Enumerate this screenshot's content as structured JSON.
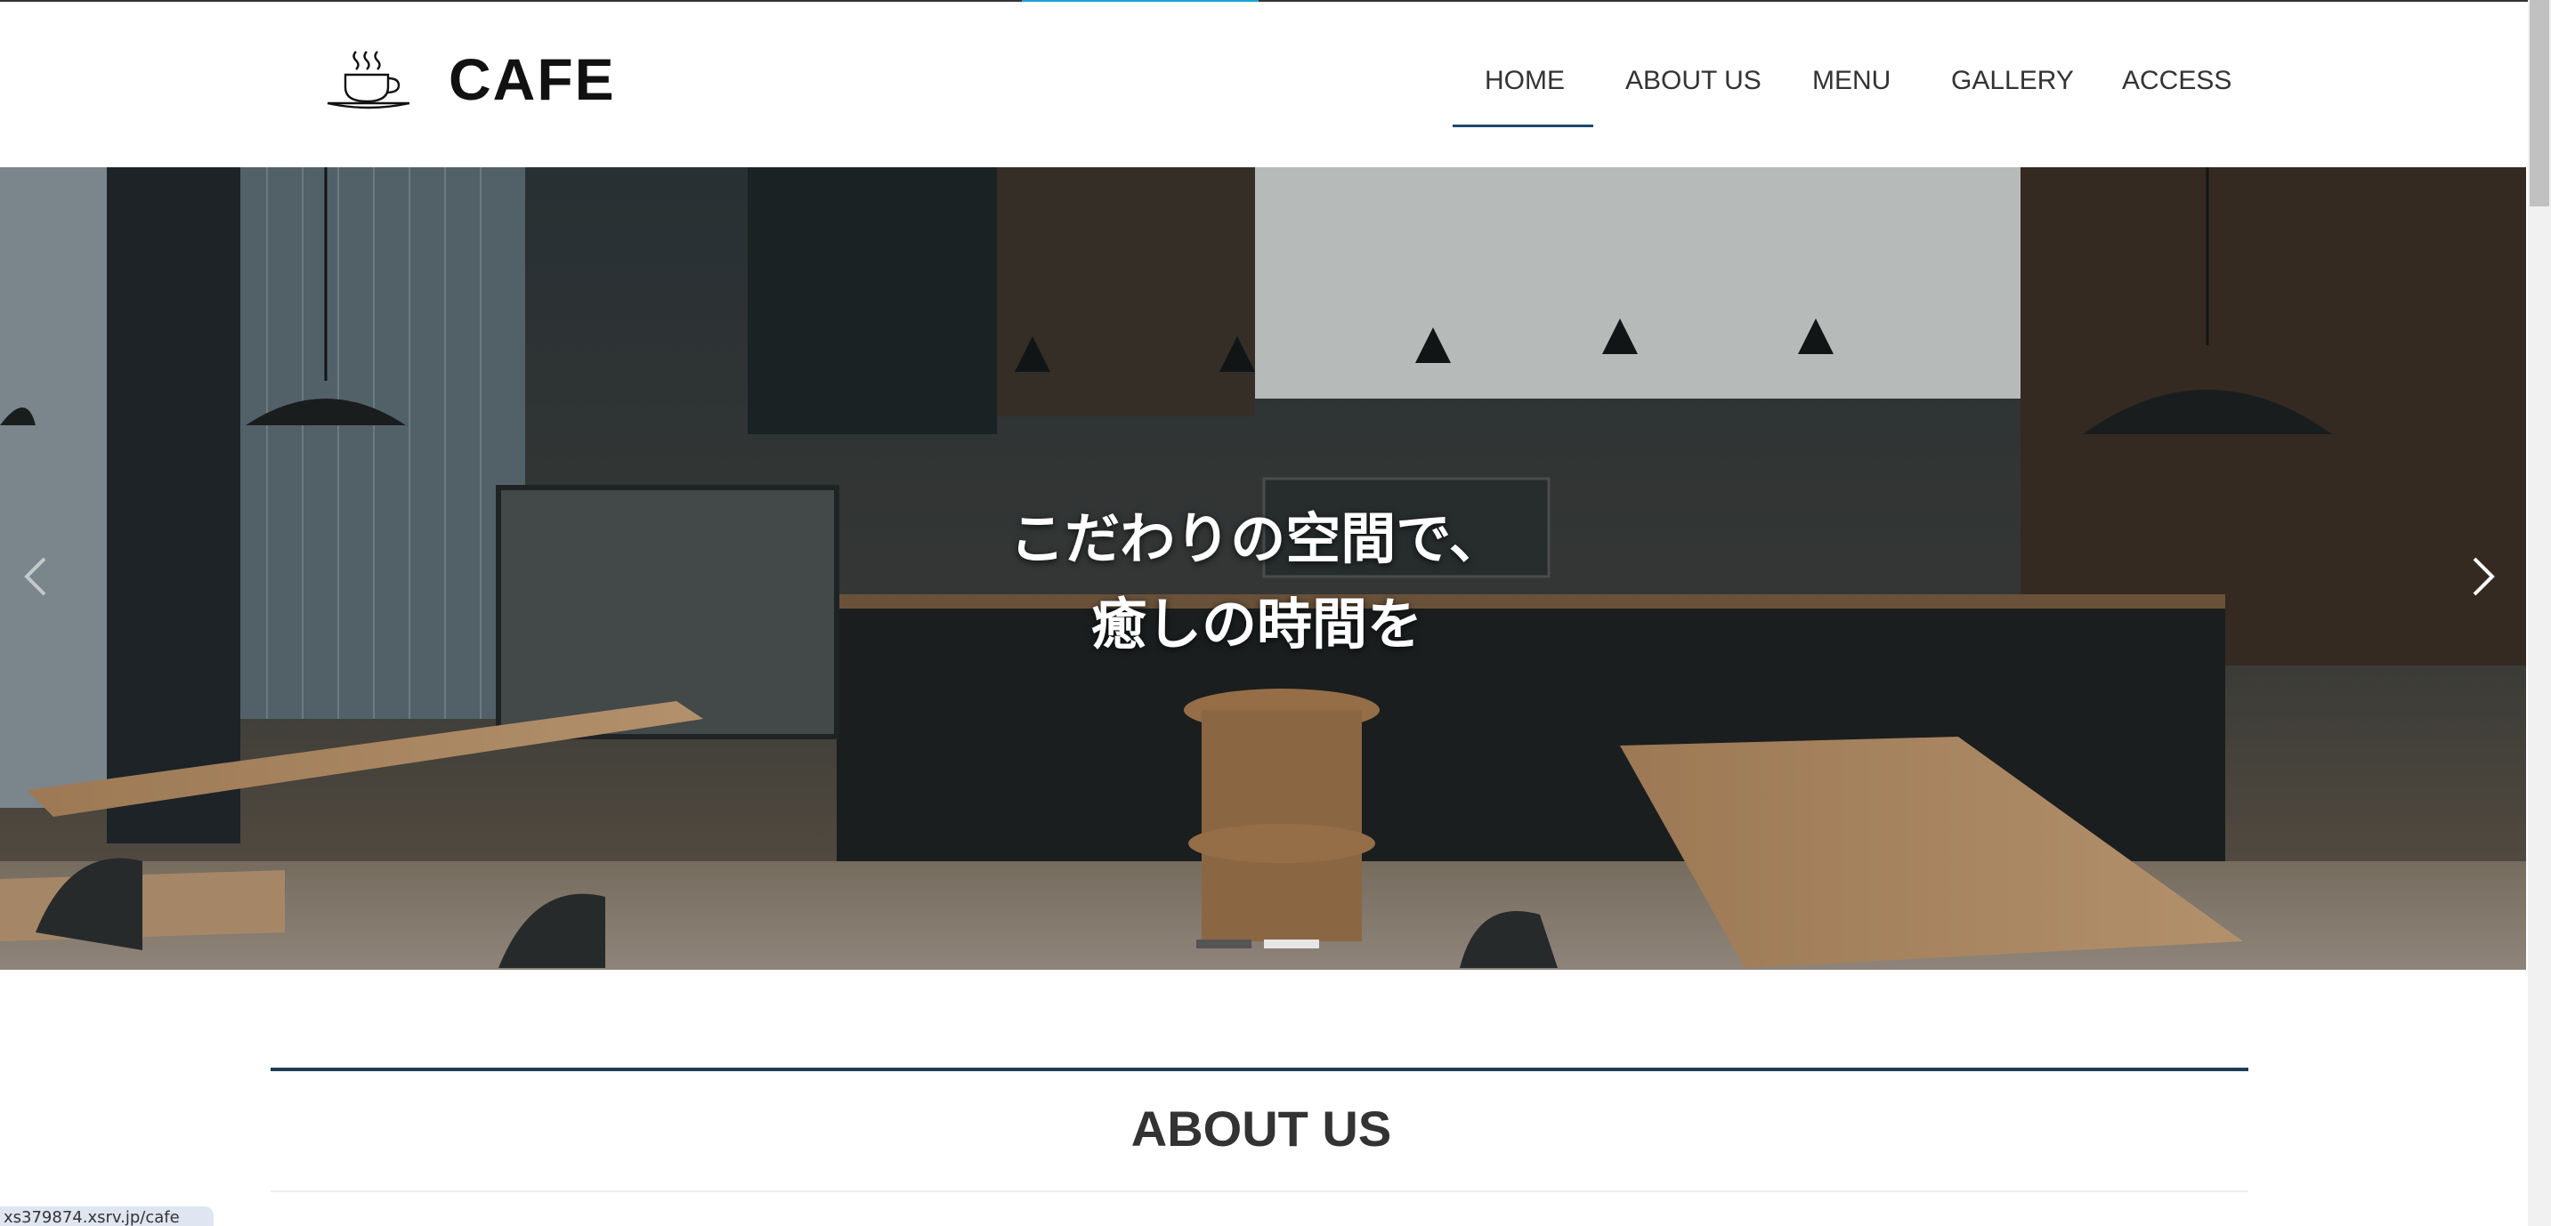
{
  "header": {
    "logo_text": "CAFE",
    "logo_icon": "coffee-cup-icon",
    "nav": [
      "HOME",
      "ABOUT US",
      "MENU",
      "GALLERY",
      "ACCESS"
    ],
    "active_nav": "HOME"
  },
  "hero": {
    "caption_line1": "こだわりの空間で、",
    "caption_line2": "癒しの時間を",
    "prev_icon": "chevron-left-icon",
    "next_icon": "chevron-right-icon",
    "slide_count": 2,
    "active_slide": 1
  },
  "about": {
    "title": "ABOUT US"
  },
  "status_bar": {
    "url": "xs379874.xsrv.jp/cafe"
  },
  "colors": {
    "accent": "#1aa3d9",
    "nav_underline": "#1c4a6b",
    "section_rule": "#1c3d55"
  }
}
